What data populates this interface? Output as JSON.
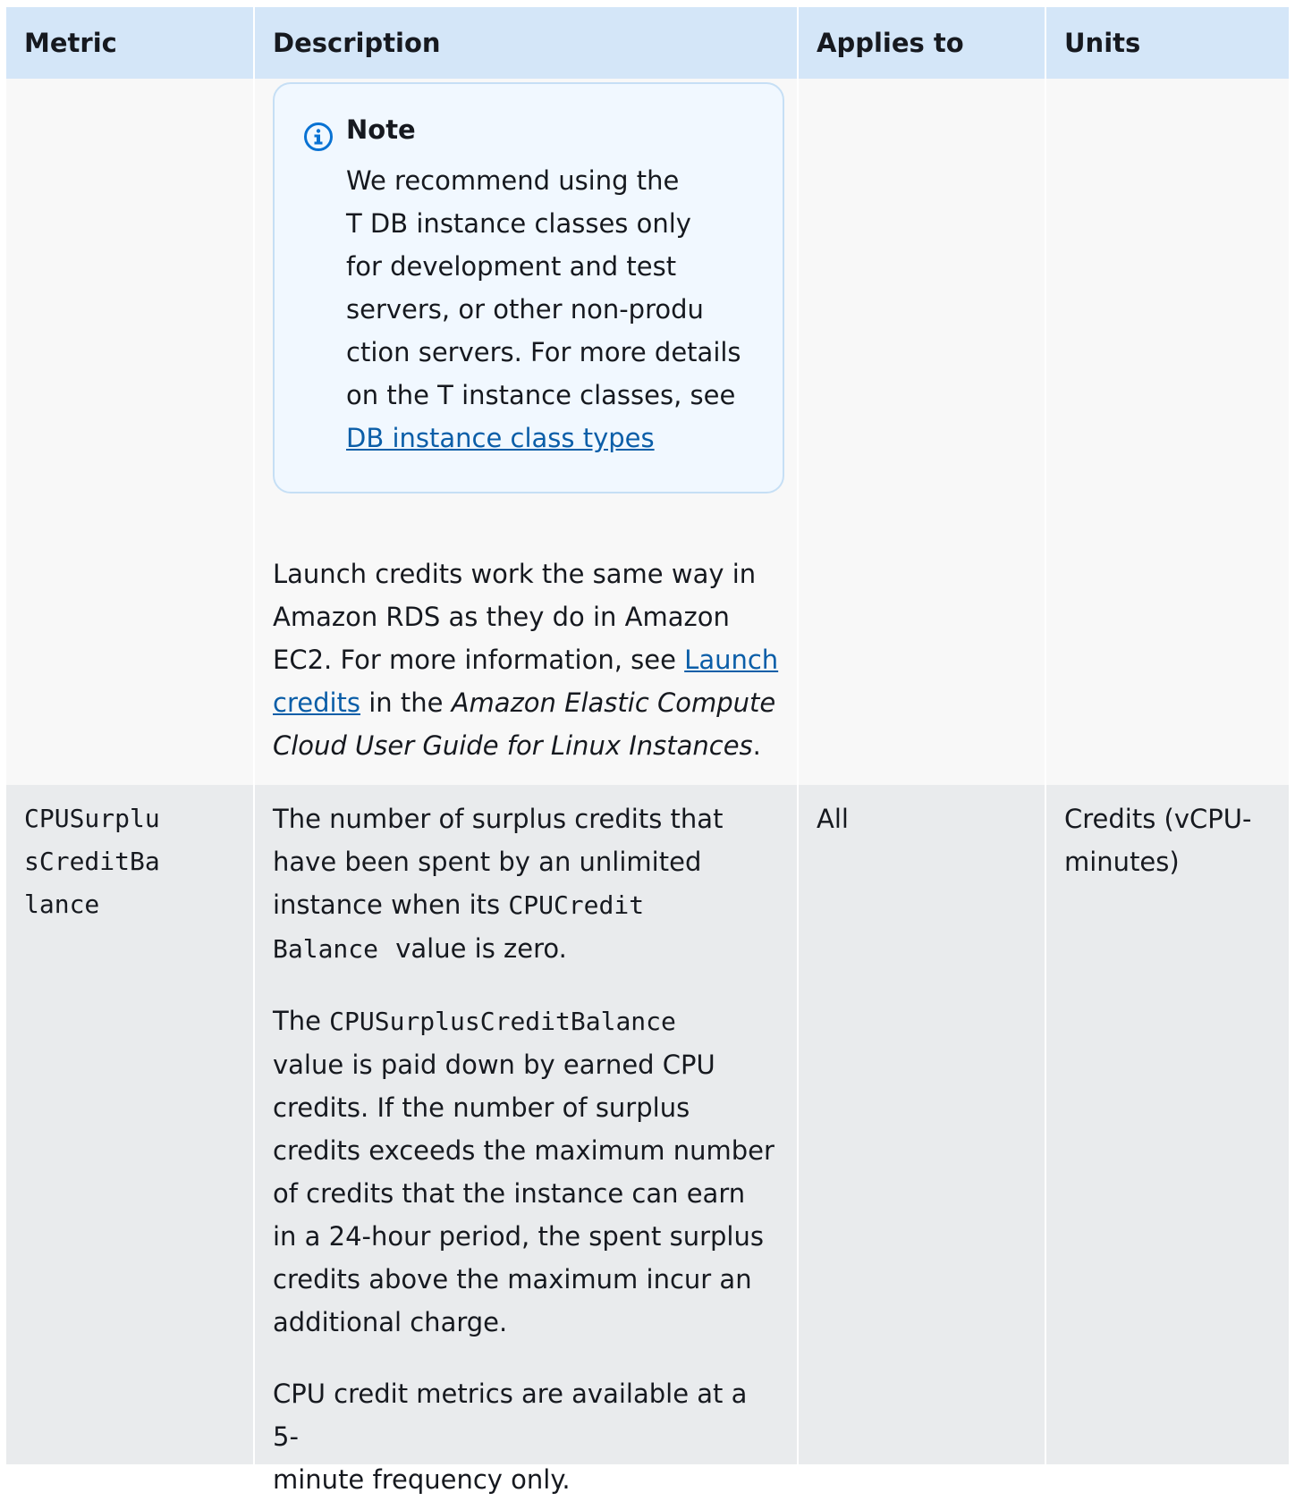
{
  "table": {
    "headers": [
      "Metric",
      "Description",
      "Applies to",
      "Units"
    ],
    "row1": {
      "note": {
        "title": "Note",
        "icon": "info-icon",
        "body_line1": "We recommend using the",
        "body_line2": "T DB instance classes only",
        "body_line3": "for development and test",
        "body_line4": "servers, or other non-produ",
        "body_line5": "ction servers. For more details",
        "body_line6": "on the T instance classes, see",
        "link": "DB instance class types"
      },
      "launch": {
        "line1": "Launch credits work the same way in",
        "line2": "Amazon RDS as they do in Amazon",
        "line3_text": "EC2. For more information, see ",
        "link1": "Launch",
        "link2": "credits",
        "line4_text": " in the ",
        "italic1": "Amazon Elastic Compute",
        "italic2": "Cloud User Guide for Linux Instances",
        "end": "."
      }
    },
    "row2": {
      "metric_line1": "CPUSurplu",
      "metric_line2": "sCreditBa",
      "metric_line3": "lance",
      "p1_line1": "The number of surplus credits that",
      "p1_line2": "have been spent by an unlimited",
      "p1_line3_text": "instance when its ",
      "p1_code1": "CPUCredit",
      "p1_code2": "Balance",
      "p1_line4_text": " value is zero.",
      "p2_text1": "The ",
      "p2_code": "CPUSurplusCreditBalance",
      "p2_lines": [
        "value is paid down by earned CPU",
        "credits. If the number of surplus",
        "credits exceeds the maximum number",
        "of credits that the instance can earn",
        "in a 24-hour period, the spent surplus",
        "credits above the maximum incur an",
        "additional charge."
      ],
      "p3_line1": "CPU credit metrics are available at a 5-",
      "p3_line2": "minute frequency only.",
      "applies_to": "All",
      "units_line1": "Credits (vCPU-",
      "units_line2": "minutes)"
    }
  },
  "colors": {
    "header_bg": "#d4e6f8",
    "row_light": "#f8f8f8",
    "row_dark": "#e9ebed",
    "note_bg": "#f1f8ff",
    "note_border": "#c6dff5",
    "link": "#0b5ea8",
    "icon": "#0972d3"
  }
}
